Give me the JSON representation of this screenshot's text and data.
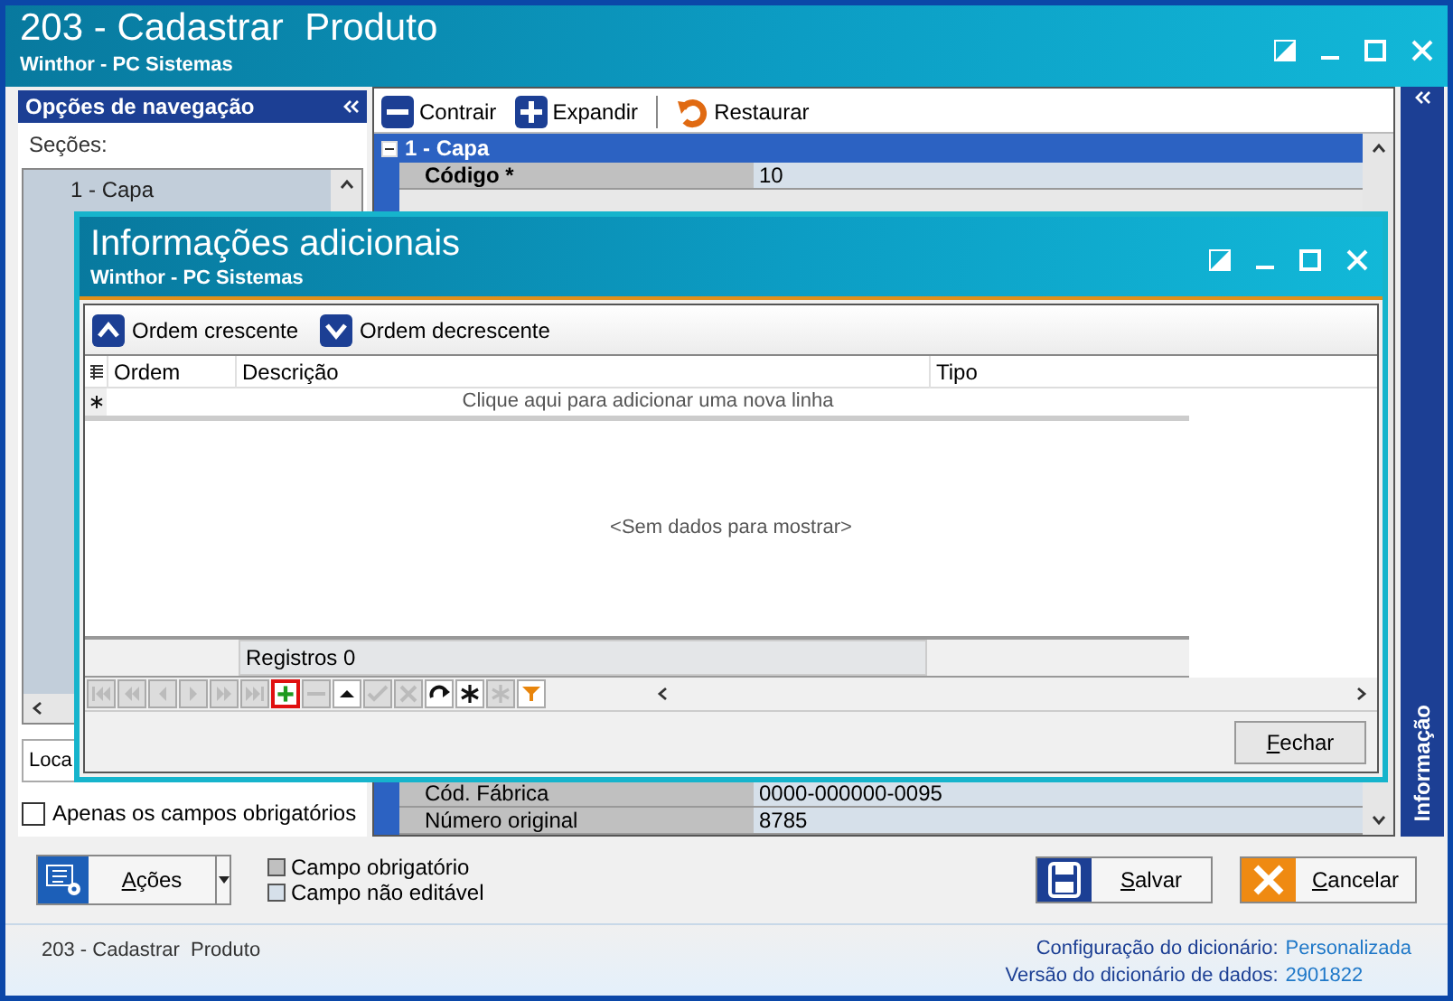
{
  "window": {
    "title": "203 - Cadastrar  Produto",
    "subtitle": "Winthor - PC Sistemas"
  },
  "navigation": {
    "header": "Opções de navegação",
    "sections_label": "Seções:",
    "tree": [
      {
        "label": "1 - Capa",
        "selected": true
      }
    ],
    "locate_field": {
      "value": "Loca"
    },
    "required_only": {
      "label": "Apenas os campos obrigatórios",
      "checked": false
    }
  },
  "toolbar": [
    {
      "label": "Contrair",
      "kind": "collapse"
    },
    {
      "label": "Expandir",
      "kind": "expand"
    },
    {
      "label": "Restaurar",
      "kind": "restore"
    }
  ],
  "property_grid": {
    "group": "1 - Capa",
    "rows": [
      {
        "label": "Código *",
        "value": "10",
        "kind": "required"
      },
      {
        "label": "Cód. Fábrica",
        "value": "0000-000000-0095",
        "kind": "normal"
      },
      {
        "label": "Número original",
        "value": "8785",
        "kind": "normal"
      }
    ]
  },
  "side_tab": "Informação",
  "dialog": {
    "title": "Informações adicionais",
    "subtitle": "Winthor - PC Sistemas",
    "toolbar": [
      {
        "label": "Ordem crescente",
        "kind": "up"
      },
      {
        "label": "Ordem decrescente",
        "kind": "down"
      }
    ],
    "columns": [
      "Ordem",
      "Descrição",
      "Tipo"
    ],
    "new_row_hint": "Clique aqui para adicionar uma nova linha",
    "empty_text": "<Sem dados para mostrar>",
    "summary": "Registros 0",
    "navigator": [
      {
        "kind": "first",
        "disabled": true,
        "highlighted": false
      },
      {
        "kind": "prev_page",
        "disabled": true,
        "highlighted": false
      },
      {
        "kind": "prev",
        "disabled": true,
        "highlighted": false
      },
      {
        "kind": "next",
        "disabled": true,
        "highlighted": false
      },
      {
        "kind": "next_page",
        "disabled": true,
        "highlighted": false
      },
      {
        "kind": "last",
        "disabled": true,
        "highlighted": false
      },
      {
        "kind": "insert",
        "disabled": false,
        "highlighted": true
      },
      {
        "kind": "delete",
        "disabled": true,
        "highlighted": false
      },
      {
        "kind": "edit",
        "disabled": false,
        "highlighted": false
      },
      {
        "kind": "post",
        "disabled": true,
        "highlighted": false
      },
      {
        "kind": "cancel",
        "disabled": true,
        "highlighted": false
      },
      {
        "kind": "refresh",
        "disabled": false,
        "highlighted": false
      },
      {
        "kind": "bookmark",
        "disabled": false,
        "highlighted": false
      },
      {
        "kind": "goto_bookmark",
        "disabled": true,
        "highlighted": false
      },
      {
        "kind": "filter",
        "disabled": false,
        "highlighted": false
      }
    ],
    "close_button": "Fechar"
  },
  "actions_button": "Ações",
  "legend": [
    {
      "label": "Campo obrigatório",
      "color": "#c0c0c0"
    },
    {
      "label": "Campo não editável",
      "color": "#d6e0ea"
    }
  ],
  "save_button": "Salvar",
  "cancel_button": "Cancelar",
  "footer": {
    "screen": "203 - Cadastrar  Produto",
    "config_label": "Configuração do dicionário:",
    "config_value": "Personalizada",
    "version_label": "Versão do dicionário de dados:",
    "version_value": "2901822"
  }
}
